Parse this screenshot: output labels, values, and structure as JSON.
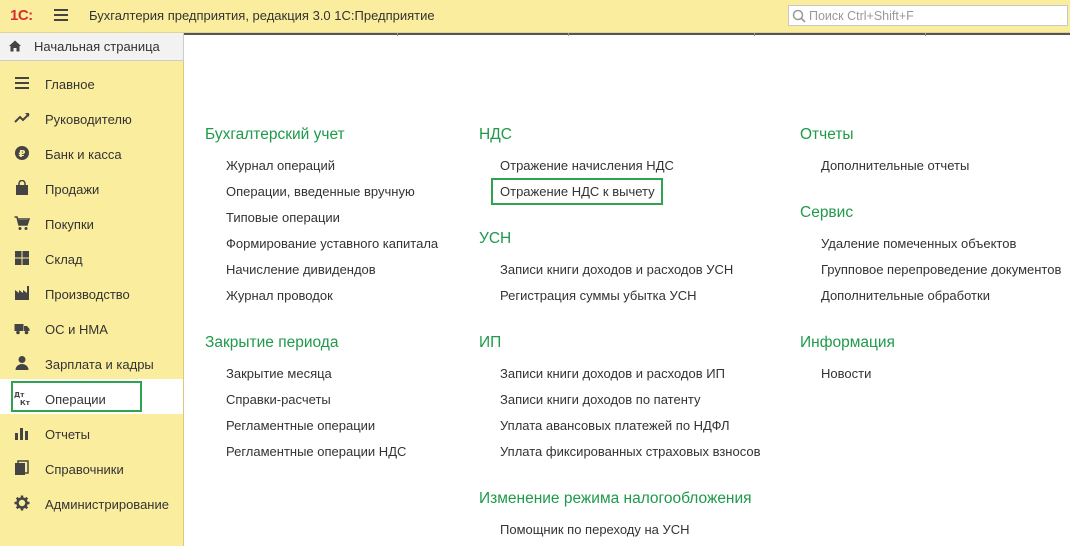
{
  "app": {
    "logo": "1С:",
    "title": "Бухгалтерия предприятия, редакция 3.0 1С:Предприятие",
    "search_placeholder": "Поиск Ctrl+Shift+F"
  },
  "home_tab": {
    "label": "Начальная страница"
  },
  "sidebar": {
    "items": [
      {
        "label": "Главное",
        "icon": "menu-lines-icon"
      },
      {
        "label": "Руководителю",
        "icon": "trend-icon"
      },
      {
        "label": "Банк и касса",
        "icon": "ruble-coin-icon"
      },
      {
        "label": "Продажи",
        "icon": "shopping-bag-icon"
      },
      {
        "label": "Покупки",
        "icon": "shopping-cart-icon"
      },
      {
        "label": "Склад",
        "icon": "warehouse-icon"
      },
      {
        "label": "Производство",
        "icon": "factory-icon"
      },
      {
        "label": "ОС и НМА",
        "icon": "truck-icon"
      },
      {
        "label": "Зарплата и кадры",
        "icon": "person-icon"
      },
      {
        "label": "Операции",
        "icon": "debit-credit-icon",
        "active": true
      },
      {
        "label": "Отчеты",
        "icon": "bar-chart-icon"
      },
      {
        "label": "Справочники",
        "icon": "books-icon"
      },
      {
        "label": "Администрирование",
        "icon": "gear-icon"
      }
    ]
  },
  "content": {
    "col1": [
      {
        "title": "Бухгалтерский учет",
        "links": [
          "Журнал операций",
          "Операции, введенные вручную",
          "Типовые операции",
          "Формирование уставного капитала",
          "Начисление дивидендов",
          "Журнал проводок"
        ]
      },
      {
        "title": "Закрытие периода",
        "links": [
          "Закрытие месяца",
          "Справки-расчеты",
          "Регламентные операции",
          "Регламентные операции НДС"
        ]
      }
    ],
    "col2": [
      {
        "title": "НДС",
        "links": [
          "Отражение начисления НДС",
          "Отражение НДС к вычету"
        ]
      },
      {
        "title": "УСН",
        "links": [
          "Записи книги доходов и расходов УСН",
          "Регистрация суммы убытка УСН"
        ]
      },
      {
        "title": "ИП",
        "links": [
          "Записи книги доходов и расходов ИП",
          "Записи книги доходов по патенту",
          "Уплата авансовых платежей по НДФЛ",
          "Уплата фиксированных страховых взносов"
        ]
      },
      {
        "title": "Изменение режима налогообложения",
        "links": [
          "Помощник по переходу на УСН"
        ]
      }
    ],
    "col3": [
      {
        "title": "Отчеты",
        "links": [
          "Дополнительные отчеты"
        ]
      },
      {
        "title": "Сервис",
        "links": [
          "Удаление помеченных объектов",
          "Групповое перепроведение документов",
          "Дополнительные обработки"
        ]
      },
      {
        "title": "Информация",
        "links": [
          "Новости"
        ]
      }
    ]
  },
  "colors": {
    "accent_green": "#1e9a4a",
    "panel_yellow": "#fbed9e",
    "highlight_border": "#2ea44f"
  }
}
